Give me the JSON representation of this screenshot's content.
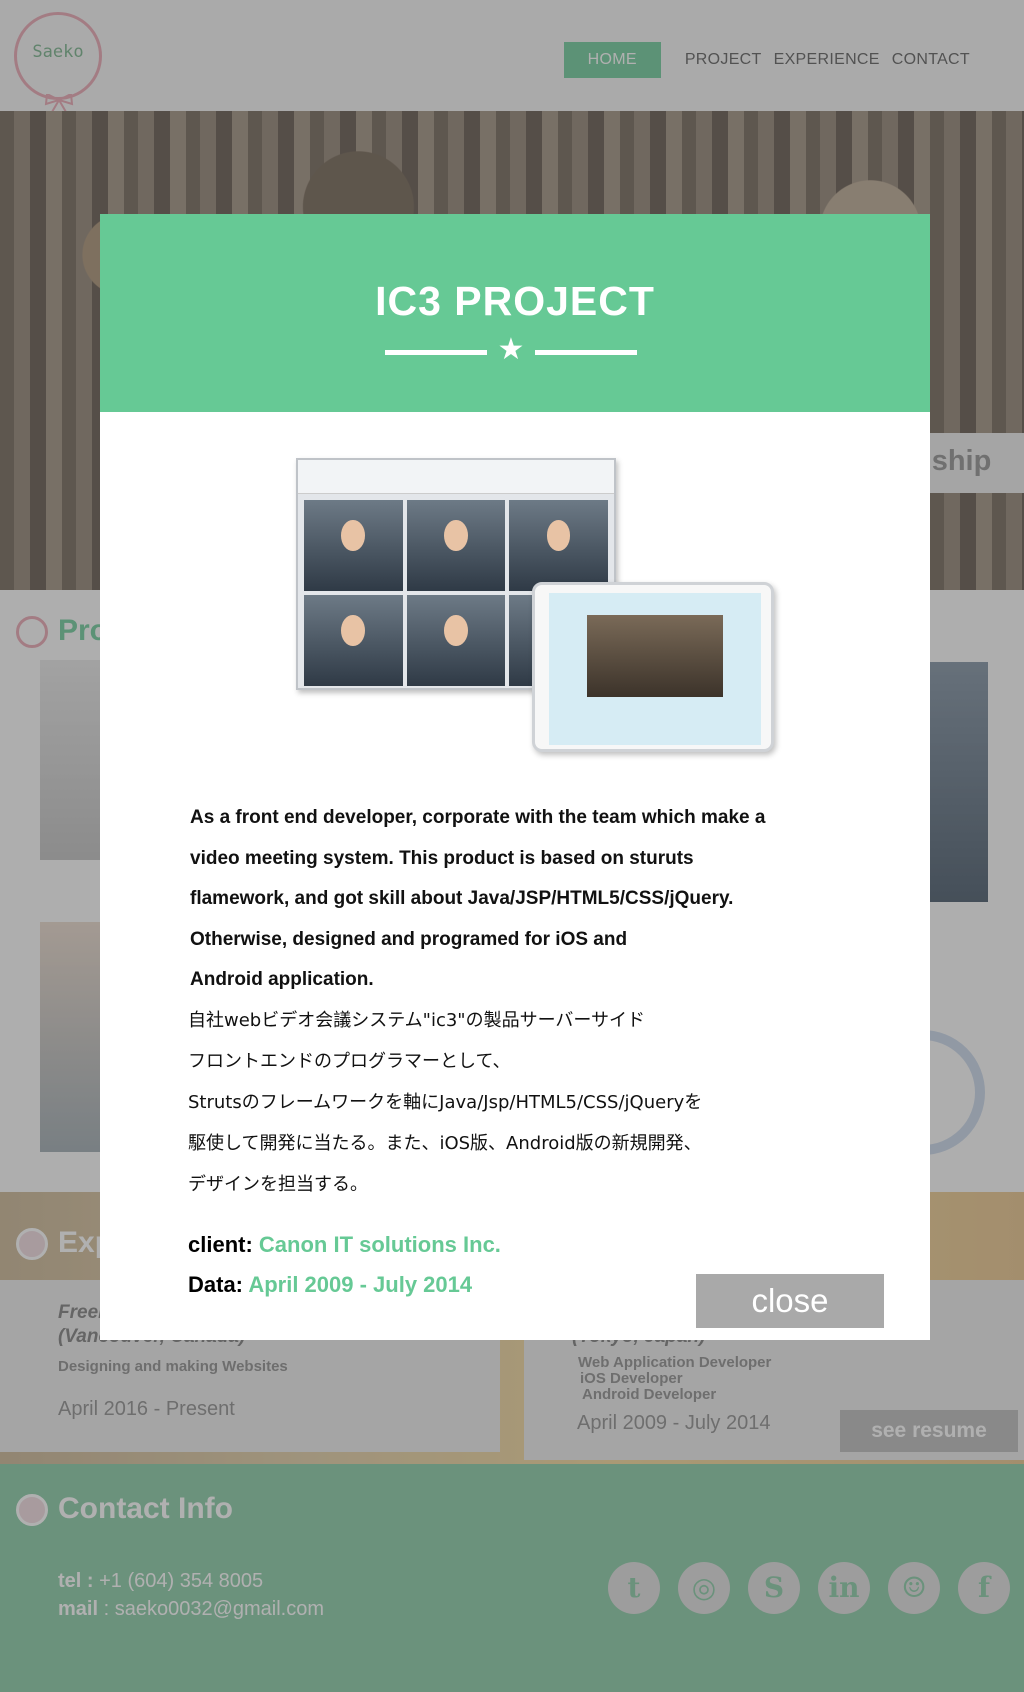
{
  "header": {
    "logo_text": "Saeko",
    "nav": [
      "HOME",
      "PROJECT",
      "EXPERIENCE",
      "CONTACT"
    ]
  },
  "hero": {
    "tag_text": "nship"
  },
  "projects": {
    "title_partial": "Pro"
  },
  "experience": {
    "title_partial": "Exp",
    "cards": [
      {
        "role_partial": "Freel",
        "location": "(Vancouver, Canada)",
        "desc": [
          "Designing and making Websites"
        ],
        "date": "April 2016 - Present"
      },
      {
        "location": "(Tokyo, Japan)",
        "desc": [
          "Web Application Developer",
          "iOS Developer",
          "Android Developer"
        ],
        "date": "April 2009 - July 2014"
      }
    ],
    "resume_button": "see resume"
  },
  "contact": {
    "title": "Contact Info",
    "tel_label": "tel :",
    "tel": "+1 (604) 354 8005",
    "mail_label": "mail",
    "mail": ": saeko0032@gmail.com",
    "socials": [
      {
        "name": "tumblr-icon",
        "glyph": "t"
      },
      {
        "name": "instagram-icon",
        "glyph": "◎"
      },
      {
        "name": "skype-icon",
        "glyph": "S"
      },
      {
        "name": "linkedin-icon",
        "glyph": "in"
      },
      {
        "name": "github-icon",
        "glyph": "☺"
      },
      {
        "name": "facebook-icon",
        "glyph": "f"
      }
    ]
  },
  "modal": {
    "title": "IC3 PROJECT",
    "description_en": [
      "As a front end developer, corporate with the team which make a",
      "video meeting system. This product is based on sturuts",
      "flamework, and got skill about Java/JSP/HTML5/CSS/jQuery.",
      "Otherwise, designed and programed for iOS and",
      "Android application."
    ],
    "description_jp": [
      "自社webビデオ会議システム\"ic3\"の製品サーバーサイド",
      "フロントエンドのプログラマーとして、",
      "Strutsのフレームワークを軸にJava/Jsp/HTML5/CSS/jQueryを",
      "駆使して開発に当たる。また、iOS版、Android版の新規開発、",
      "デザインを担当する。"
    ],
    "client_label": "client:",
    "client": "Canon IT solutions Inc.",
    "data_label": "Data:",
    "data": "April 2009 - July 2014",
    "close_label": "close"
  },
  "colors": {
    "accent": "#66c995",
    "logo_pink": "#e7a1ae",
    "button_gray": "#a9a9a9"
  }
}
